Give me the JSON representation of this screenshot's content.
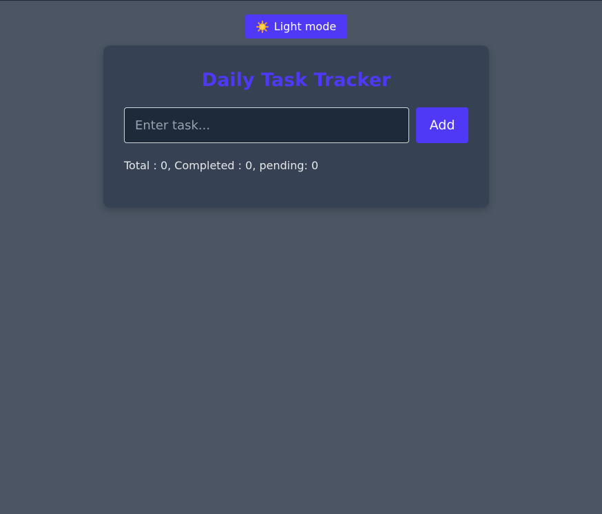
{
  "theme_toggle": {
    "icon": "sun-icon",
    "label": "Light mode"
  },
  "tracker": {
    "title": "Daily Task Tracker",
    "input": {
      "placeholder": "Enter task...",
      "value": ""
    },
    "add_label": "Add",
    "stats": {
      "total_label": "Total : ",
      "total": "0",
      "completed_label": ", Completed : ",
      "completed": "0",
      "pending_label": ", pending: ",
      "pending": "0"
    }
  },
  "colors": {
    "page_background": "#4b5563",
    "card_background": "#364153",
    "accent": "#4f39f6",
    "input_background": "#1e2939",
    "text": "#e5e7eb"
  }
}
